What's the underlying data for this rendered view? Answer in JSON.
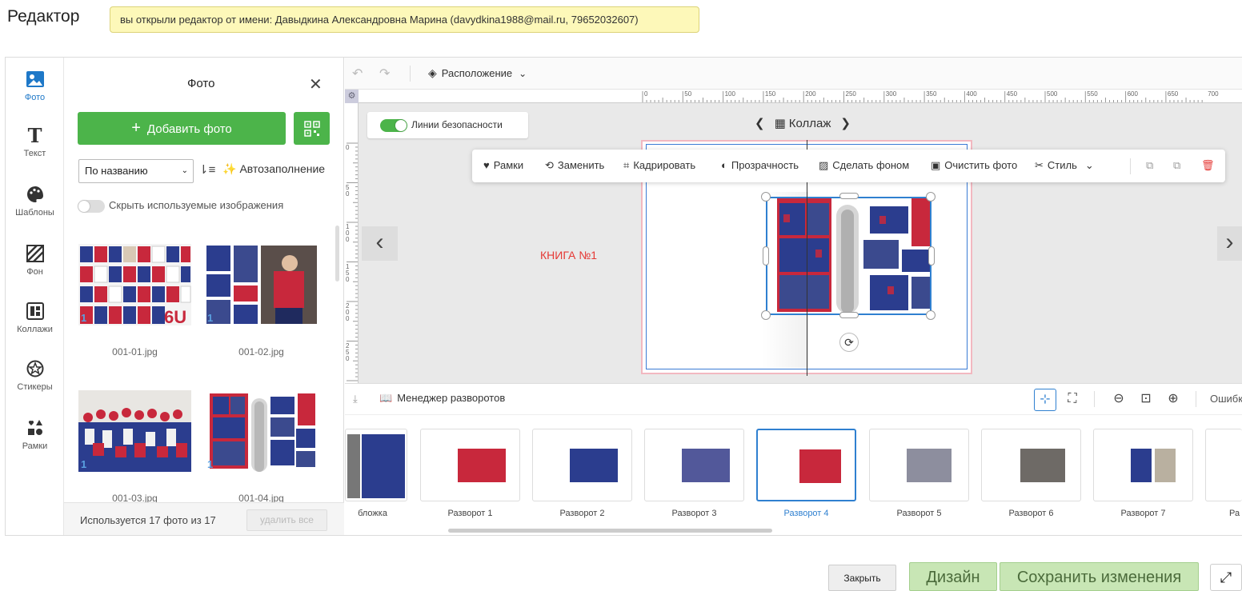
{
  "header": {
    "title": "Редактор",
    "user_banner": "вы открыли редактор от имени: Давыдкина Александровна Марина (davydkina1988@mail.ru, 79652032607)"
  },
  "sidenav": {
    "items": [
      {
        "label": "Фото",
        "icon": "image-icon",
        "glyph": "🖾",
        "active": true
      },
      {
        "label": "Текст",
        "icon": "text-icon",
        "glyph": "T",
        "active": false
      },
      {
        "label": "Шаблоны",
        "icon": "palette-icon",
        "glyph": "🎨",
        "active": false
      },
      {
        "label": "Фон",
        "icon": "background-icon",
        "glyph": "▨",
        "active": false
      },
      {
        "label": "Коллажи",
        "icon": "collage-icon",
        "glyph": "⊞",
        "active": false
      },
      {
        "label": "Стикеры",
        "icon": "sticker-icon",
        "glyph": "✪",
        "active": false
      },
      {
        "label": "Рамки",
        "icon": "frames-icon",
        "glyph": "♥",
        "active": false
      }
    ]
  },
  "photo_panel": {
    "title": "Фото",
    "add_button": "Добавить фото",
    "sort_value": "По названию",
    "autofill": "Автозаполнение",
    "hide_used": "Скрыть используемые изображения",
    "photos": [
      {
        "name": "001-01.jpg",
        "badge": "1"
      },
      {
        "name": "001-02.jpg",
        "badge": "1"
      },
      {
        "name": "001-03.jpg",
        "badge": "1"
      },
      {
        "name": "001-04.jpg",
        "badge": "1"
      }
    ],
    "used_count": "Используется 17 фото из 17",
    "delete_all": "удалить все"
  },
  "toolbar": {
    "layout": "Расположение"
  },
  "ruler": {
    "top": [
      "0",
      "50",
      "100",
      "150",
      "200",
      "250",
      "300",
      "350",
      "400",
      "450",
      "500",
      "550",
      "600",
      "650",
      "700"
    ],
    "left": [
      "0",
      "5 0",
      "1 0 0",
      "1 5 0",
      "2 0 0",
      "2 5 0"
    ]
  },
  "workspace": {
    "safety_lines": "Линии безопасности",
    "collage_nav": "Коллаж",
    "book_label": "КНИГА №1"
  },
  "float_toolbar": {
    "frames": "Рамки",
    "replace": "Заменить",
    "crop": "Кадрировать",
    "transparency": "Прозрачность",
    "make_bg": "Сделать фоном",
    "clear_photo": "Очистить фото",
    "style": "Стиль"
  },
  "manager": {
    "title": "Менеджер разворотов",
    "errors": "Ошибк"
  },
  "spreads": [
    {
      "label": "бложка",
      "active": false
    },
    {
      "label": "Разворот 1",
      "active": false
    },
    {
      "label": "Разворот 2",
      "active": false
    },
    {
      "label": "Разворот 3",
      "active": false
    },
    {
      "label": "Разворот 4",
      "active": true
    },
    {
      "label": "Разворот 5",
      "active": false
    },
    {
      "label": "Разворот 6",
      "active": false
    },
    {
      "label": "Разворот 7",
      "active": false
    },
    {
      "label": "Ра",
      "active": false
    }
  ],
  "footer": {
    "close": "Закрыть",
    "design": "Дизайн",
    "save": "Сохранить изменения"
  },
  "colors": {
    "accent_green": "#4cb44a",
    "accent_blue": "#2f80d0",
    "photo_blue": "#2b3d8e",
    "photo_red": "#c8283c"
  }
}
